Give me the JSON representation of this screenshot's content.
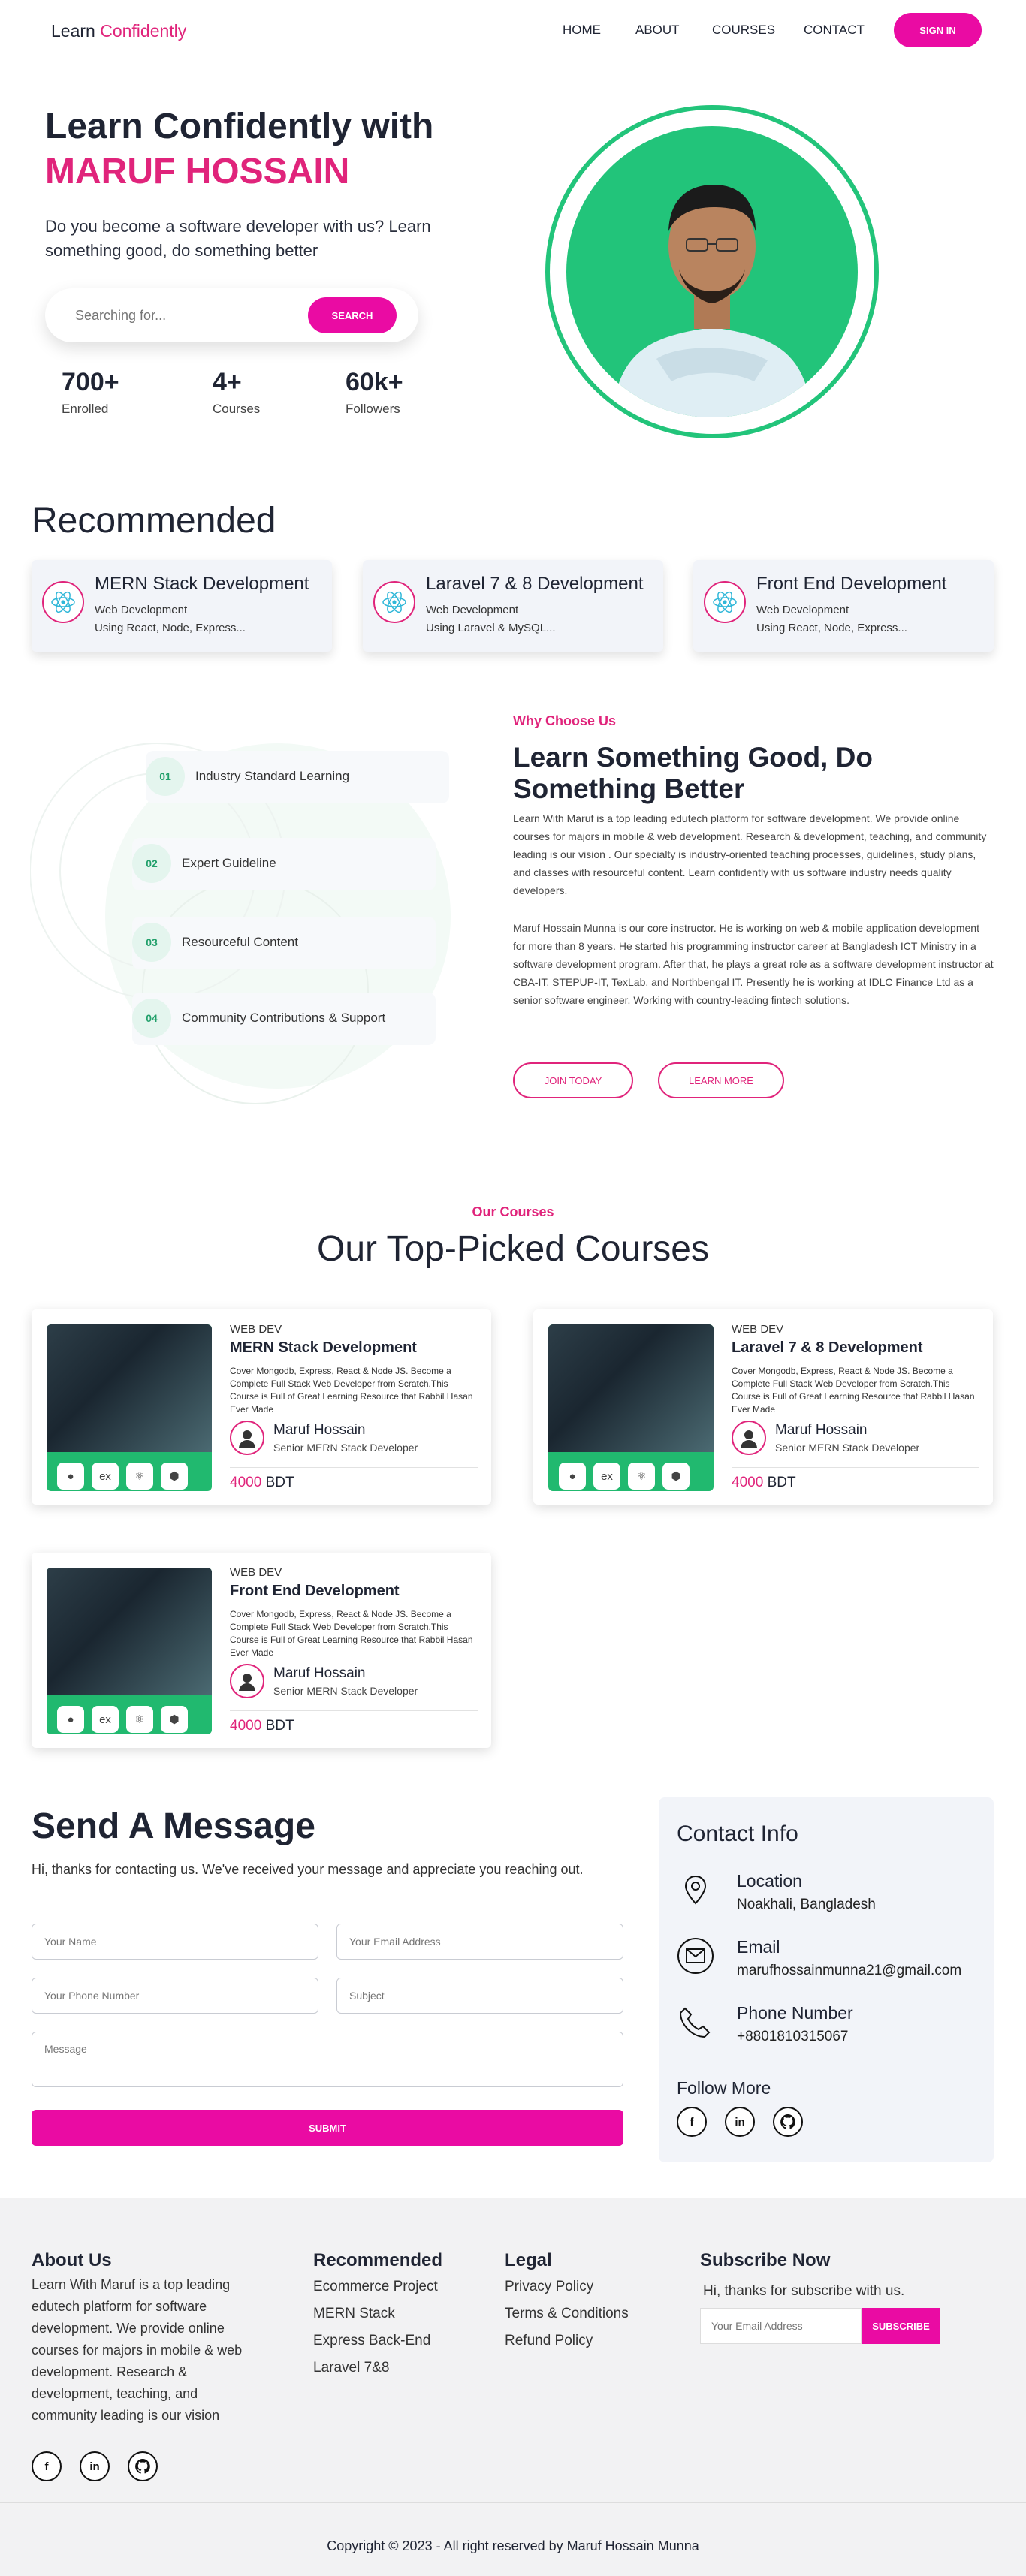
{
  "nav": {
    "logo_main": "Learn",
    "logo_accent": "Confidently",
    "items": [
      "HOME",
      "ABOUT",
      "COURSES",
      "CONTACT"
    ],
    "signin": "SIGN IN"
  },
  "hero": {
    "title_line1": "Learn Confidently with",
    "title_line2": "MARUF HOSSAIN",
    "subtitle": "Do you become a software developer with us? Learn something good, do something better",
    "search_placeholder": "Searching for...",
    "search_button": "SEARCH",
    "stats": [
      {
        "value": "700+",
        "label": "Enrolled"
      },
      {
        "value": "4+",
        "label": "Courses"
      },
      {
        "value": "60k+",
        "label": "Followers"
      }
    ]
  },
  "recommended": {
    "title": "Recommended",
    "cards": [
      {
        "title": "MERN Stack Development",
        "sub1": "Web Development",
        "sub2": "Using React, Node, Express..."
      },
      {
        "title": "Laravel 7 & 8 Development",
        "sub1": "Web Development",
        "sub2": "Using Laravel & MySQL..."
      },
      {
        "title": "Front End Development",
        "sub1": "Web Development",
        "sub2": "Using React, Node, Express..."
      }
    ]
  },
  "why": {
    "eyebrow": "Why Choose Us",
    "title": "Learn Something Good, Do Something Better",
    "para1": "Learn With Maruf is a top leading edutech platform for software development. We provide online courses for majors in mobile & web development. Research & development, teaching, and community leading is our vision . Our specialty is industry-oriented teaching processes, guidelines, study plans, and classes with resourceful content. Learn confidently with us software industry needs quality developers.",
    "para2": "Maruf Hossain Munna is our core instructor. He is working on web & mobile application development for more than 8 years. He started his programming instructor career at Bangladesh ICT Ministry in a software development program. After that, he plays a great role as a software development instructor at CBA-IT, STEPUP-IT, TexLab, and Northbengal IT. Presently he is working at IDLC Finance Ltd as a senior software engineer. Working with country-leading fintech solutions.",
    "join_button": "JOIN TODAY",
    "learn_button": "LEARN MORE",
    "steps": [
      {
        "num": "01",
        "label": "Industry Standard Learning"
      },
      {
        "num": "02",
        "label": "Expert Guideline"
      },
      {
        "num": "03",
        "label": "Resourceful Content"
      },
      {
        "num": "04",
        "label": "Community Contributions & Support"
      }
    ]
  },
  "courses": {
    "eyebrow": "Our Courses",
    "title": "Our Top-Picked Courses",
    "items": [
      {
        "category": "WEB DEV",
        "title": "MERN Stack Development",
        "desc": "Cover Mongodb, Express, React & Node JS. Become a Complete Full Stack Web Developer from Scratch.This Course is Full of Great Learning Resource that Rabbil Hasan Ever Made",
        "author": "Maruf Hossain",
        "role": "Senior MERN Stack Developer",
        "price": "4000",
        "currency": "BDT"
      },
      {
        "category": "WEB DEV",
        "title": "Laravel 7 & 8 Development",
        "desc": "Cover Mongodb, Express, React & Node JS. Become a Complete Full Stack Web Developer from Scratch.This Course is Full of Great Learning Resource that Rabbil Hasan Ever Made",
        "author": "Maruf Hossain",
        "role": "Senior MERN Stack Developer",
        "price": "4000",
        "currency": "BDT"
      },
      {
        "category": "WEB DEV",
        "title": "Front End Development",
        "desc": "Cover Mongodb, Express, React & Node JS. Become a Complete Full Stack Web Developer from Scratch.This Course is Full of Great Learning Resource that Rabbil Hasan Ever Made",
        "author": "Maruf Hossain",
        "role": "Senior MERN Stack Developer",
        "price": "4000",
        "currency": "BDT"
      }
    ],
    "tags": [
      "mongo",
      "ex",
      "react",
      "node"
    ]
  },
  "contact": {
    "title": "Send A Message",
    "subtitle": "Hi, thanks for contacting us. We've received your message and appreciate you reaching out.",
    "name_placeholder": "Your Name",
    "email_placeholder": "Your Email Address",
    "phone_placeholder": "Your Phone Number",
    "subject_placeholder": "Subject",
    "message_placeholder": "Message",
    "submit": "SUBMIT",
    "info": {
      "title": "Contact Info",
      "location_label": "Location",
      "location_value": "Noakhali, Bangladesh",
      "email_label": "Email",
      "email_value": "marufhossainmunna21@gmail.com",
      "phone_label": "Phone Number",
      "phone_value": "+8801810315067",
      "follow": "Follow More"
    }
  },
  "footer": {
    "about_title": "About Us",
    "about_text": "Learn With Maruf is a top leading edutech platform for software development. We provide online courses for majors in mobile & web development. Research & development, teaching, and community leading is our vision",
    "recommended_title": "Recommended",
    "recommended_links": [
      "Ecommerce Project",
      "MERN Stack",
      "Express Back-End",
      "Laravel 7&8"
    ],
    "legal_title": "Legal",
    "legal_links": [
      "Privacy Policy",
      "Terms & Conditions",
      "Refund Policy"
    ],
    "subscribe_title": "Subscribe Now",
    "subscribe_text": "Hi, thanks for subscribe with us.",
    "subscribe_placeholder": "Your Email Address",
    "subscribe_button": "SUBSCRIBE",
    "copyright": "Copyright © 2023 - All right reserved by Maruf Hossain Munna"
  },
  "social": {
    "facebook": "f",
    "linkedin": "in",
    "github": "gh"
  },
  "colors": {
    "accent": "#e0247b",
    "button": "#ea0ba3",
    "green": "#22c47a",
    "card_bg": "#f2f4f9"
  }
}
